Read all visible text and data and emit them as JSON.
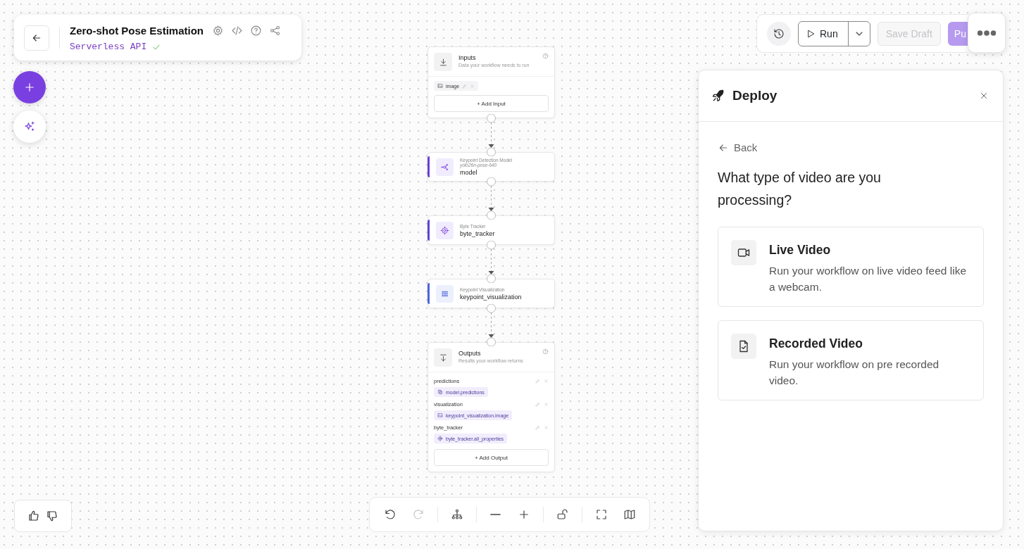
{
  "header": {
    "title": "Zero-shot Pose Estimation",
    "subtitle": "Serverless API",
    "deployed": true
  },
  "toolbar": {
    "run": "Run",
    "save_draft": {
      "label": "Save Draft",
      "disabled": true
    },
    "publish": {
      "label": "Pu",
      "disabled": true
    }
  },
  "workflow": {
    "inputs": {
      "title": "Inputs",
      "description": "Data your workflow needs to run",
      "items": [
        {
          "kind": "image",
          "name": "image"
        }
      ],
      "add_label": "+ Add Input"
    },
    "blocks": [
      {
        "kind": "model",
        "type": "Keypoint Detection Model",
        "subtitle": "yolo26n-pose-640",
        "name": "model",
        "color": "#6b3fd4"
      },
      {
        "kind": "tracker",
        "type": "Byte Tracker",
        "name": "byte_tracker",
        "color": "#5a45d2"
      },
      {
        "kind": "visualization",
        "type": "Keypoint Visualization",
        "name": "keypoint_visualization",
        "color": "#4d63da"
      }
    ],
    "outputs": {
      "title": "Outputs",
      "description": "Results your workflow returns",
      "items": [
        {
          "kind": "predictions",
          "name": "predictions",
          "value": "model.predictions"
        },
        {
          "kind": "image",
          "name": "visualization",
          "value": "keypoint_visualization.image"
        },
        {
          "kind": "tracker",
          "name": "byte_tracker",
          "value": "byte_tracker.all_properties"
        }
      ],
      "add_label": "+ Add Output"
    }
  },
  "controls": {
    "redo_disabled": true,
    "locked": false
  },
  "deploy": {
    "title": "Deploy",
    "back": "Back",
    "question": "What type of video are you processing?",
    "options": [
      {
        "kind": "live",
        "title": "Live Video",
        "description": "Run your workflow on live video feed like a webcam."
      },
      {
        "kind": "recorded",
        "title": "Recorded Video",
        "description": "Run your workflow on pre recorded video."
      }
    ]
  }
}
